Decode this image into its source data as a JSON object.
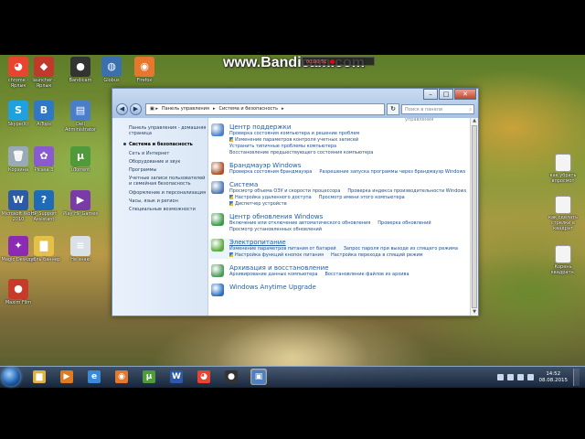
{
  "watermark": {
    "text": "www.Bandicam.com",
    "rec_time": "00:00:51"
  },
  "desktop_icons_left": [
    {
      "label": "chrome - Ярлык",
      "icon": "chrome-icon",
      "color": "#e8442f",
      "glyph": "◕"
    },
    {
      "label": "launcher - Ярлык",
      "icon": "launcher-icon",
      "color": "#c0392b",
      "glyph": "◆"
    },
    {
      "label": "Bandicam",
      "icon": "bandicam-icon",
      "color": "#333",
      "glyph": "●"
    },
    {
      "label": "Globus",
      "icon": "globus-icon",
      "color": "#3a6fb0",
      "glyph": "◍"
    },
    {
      "label": "Firefox",
      "icon": "firefox-icon",
      "color": "#e8772e",
      "glyph": "◉"
    },
    {
      "label": "Skype(R)",
      "icon": "skype-icon",
      "color": "#1fa1e0",
      "glyph": "S"
    },
    {
      "label": "AiTops",
      "icon": "aitops-icon",
      "color": "#2e78c7",
      "glyph": "B"
    },
    {
      "label": "Dell Administrator",
      "icon": "dell-icon",
      "color": "#4a7ec8",
      "glyph": "▤"
    },
    {
      "label": "Корзина",
      "icon": "recycle-bin-icon",
      "color": "#9aa9b8",
      "glyph": "🗑"
    },
    {
      "label": "Picasa 3",
      "icon": "picasa-icon",
      "color": "#8a5bd0",
      "glyph": "✿"
    },
    {
      "label": "uTorrent",
      "icon": "utorrent-icon",
      "color": "#4f9a3a",
      "glyph": "µ"
    },
    {
      "label": "Microsoft Word 2010",
      "icon": "word-icon",
      "color": "#2b5ba8",
      "glyph": "W"
    },
    {
      "label": "HP Support Assistant",
      "icon": "hp-icon",
      "color": "#1f6bb7",
      "glyph": "?"
    },
    {
      "label": "Play HP Games",
      "icon": "hp-games-icon",
      "color": "#7a3aa8",
      "glyph": "▶"
    },
    {
      "label": "Magic Desktop",
      "icon": "magic-desktop-icon",
      "color": "#8b2bb3",
      "glyph": "✦"
    },
    {
      "label": "дубль баннер",
      "icon": "folder-icon",
      "color": "#e4c04a",
      "glyph": "▇"
    },
    {
      "label": "Не знаю",
      "icon": "document-icon",
      "color": "#d9e0e8",
      "glyph": "≡"
    },
    {
      "label": "Maxim Film",
      "icon": "maxim-icon",
      "color": "#c83a2a",
      "glyph": "●"
    }
  ],
  "desktop_icons_right": [
    {
      "label": "как убрать впросмот",
      "icon": "text-file-icon"
    },
    {
      "label": "как сделать стрелки в квадрат",
      "icon": "text-file-icon"
    },
    {
      "label": "Корень квадратн.",
      "icon": "text-file-icon"
    }
  ],
  "window": {
    "address": [
      "Панель управления",
      "Система и безопасность"
    ],
    "search_placeholder": "Поиск в панели управления",
    "sidebar": [
      {
        "label": "Панель управления - домашняя страница",
        "selected": false
      },
      {
        "label": "Система и безопасность",
        "selected": true
      },
      {
        "label": "Сеть и Интернет",
        "selected": false
      },
      {
        "label": "Оборудование и звук",
        "selected": false
      },
      {
        "label": "Программы",
        "selected": false
      },
      {
        "label": "Учетные записи пользователей и семейная безопасность",
        "selected": false
      },
      {
        "label": "Оформление и персонализация",
        "selected": false
      },
      {
        "label": "Часы, язык и регион",
        "selected": false
      },
      {
        "label": "Специальные возможности",
        "selected": false
      }
    ],
    "sections": [
      {
        "title": "Центр поддержки",
        "icon": "flag-icon",
        "color": "#4a80c8",
        "highlight": false,
        "links": [
          "Проверка состояния компьютера и решение проблем",
          "Изменение параметров контроля учетных записей",
          "Устранить типичные проблемы компьютера",
          "Восстановление предшествующего состояния компьютера"
        ]
      },
      {
        "title": "Брандмауэр Windows",
        "icon": "firewall-icon",
        "color": "#b0502a",
        "highlight": false,
        "links": [
          "Проверка состояния брандмауэра",
          "Разрешение запуска программы через брандмауэр Windows"
        ]
      },
      {
        "title": "Система",
        "icon": "computer-icon",
        "color": "#4a78b0",
        "highlight": false,
        "links": [
          "Просмотр объема ОЗУ и скорости процессора",
          "Проверка индекса производительности Windows",
          "Настройка удаленного доступа",
          "Просмотр имени этого компьютера",
          "Диспетчер устройств"
        ]
      },
      {
        "title": "Центр обновления Windows",
        "icon": "update-icon",
        "color": "#3a9a4a",
        "highlight": false,
        "links": [
          "Включение или отключение автоматического обновления",
          "Проверка обновлений",
          "Просмотр установленных обновлений"
        ]
      },
      {
        "title": "Электропитание",
        "icon": "battery-icon",
        "color": "#5aaa3a",
        "highlight": true,
        "links": [
          "Изменение параметров питания от батарей",
          "Запрос пароля при выходе из спящего режима",
          "Настройка функций кнопок питания",
          "Настройка перехода в спящий режим"
        ]
      },
      {
        "title": "Архивация и восстановление",
        "icon": "backup-icon",
        "color": "#4a9a5a",
        "highlight": false,
        "links": [
          "Архивирование данных компьютера",
          "Восстановление файлов из архива"
        ]
      },
      {
        "title": "Windows Anytime Upgrade",
        "icon": "windows-icon",
        "color": "#2a70c0",
        "highlight": false,
        "links": []
      }
    ]
  },
  "taskbar": {
    "apps": [
      {
        "name": "explorer-taskbar-icon",
        "color": "#e0b040",
        "glyph": "▆",
        "active": false
      },
      {
        "name": "media-player-taskbar-icon",
        "color": "#e07a20",
        "glyph": "▶",
        "active": false
      },
      {
        "name": "ie-taskbar-icon",
        "color": "#3a8ad8",
        "glyph": "e",
        "active": false
      },
      {
        "name": "firefox-taskbar-icon",
        "color": "#e8772e",
        "glyph": "◉",
        "active": false
      },
      {
        "name": "utorrent-taskbar-icon",
        "color": "#4f9a3a",
        "glyph": "µ",
        "active": false
      },
      {
        "name": "word-taskbar-icon",
        "color": "#2b5ba8",
        "glyph": "W",
        "active": false
      },
      {
        "name": "chrome-taskbar-icon",
        "color": "#e8442f",
        "glyph": "◕",
        "active": false
      },
      {
        "name": "bandicam-taskbar-icon",
        "color": "#333333",
        "glyph": "●",
        "active": false
      },
      {
        "name": "control-panel-taskbar-icon",
        "color": "#4a80c8",
        "glyph": "▣",
        "active": true
      }
    ],
    "time": "14:52",
    "date": "08.08.2015"
  }
}
